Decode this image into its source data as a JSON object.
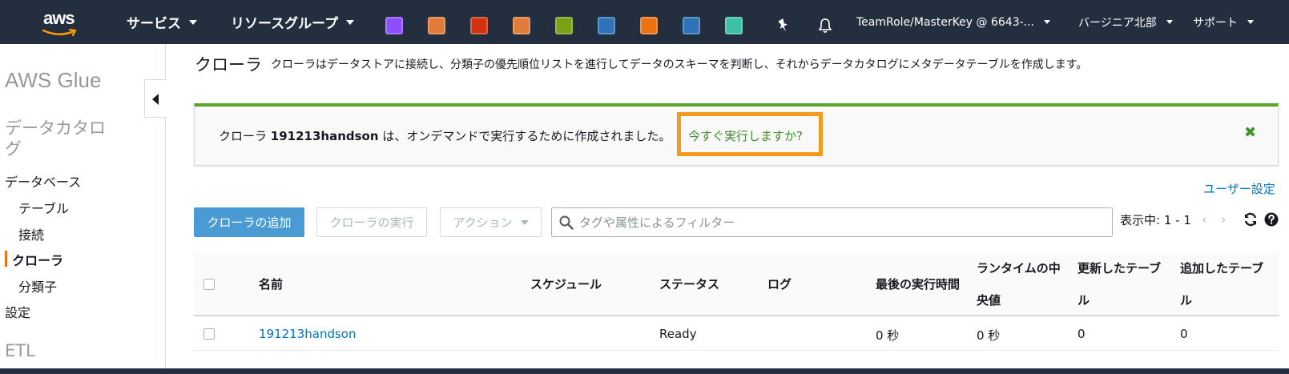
{
  "topnav": {
    "logo_text": "aws",
    "services_label": "サービス",
    "resource_groups_label": "リソースグループ",
    "service_icons": [
      {
        "name": "athena-icon",
        "color": "#8c4fff"
      },
      {
        "name": "sagemaker-icon",
        "color": "#e07b39"
      },
      {
        "name": "redshift-icon",
        "color": "#d13212"
      },
      {
        "name": "datasync-icon",
        "color": "#e07b39"
      },
      {
        "name": "kms-icon",
        "color": "#7aa116"
      },
      {
        "name": "redshift-cluster-icon",
        "color": "#2e73b8"
      },
      {
        "name": "ec2-icon",
        "color": "#ec7211"
      },
      {
        "name": "dynamodb-icon",
        "color": "#2e73b8"
      },
      {
        "name": "glue-icon",
        "color": "#3cbfa3"
      }
    ],
    "pin_icon": "pin-icon",
    "bell_icon": "bell-icon",
    "account_label": "TeamRole/MasterKey @ 6643-...",
    "region_label": "バージニア北部",
    "support_label": "サポート"
  },
  "sidebar": {
    "title": "AWS Glue",
    "section_catalog": "データカタロ\nグ",
    "items": [
      {
        "label": "データベース",
        "active": false
      },
      {
        "label": "テーブル",
        "active": false
      },
      {
        "label": "接続",
        "active": false
      },
      {
        "label": "クローラ",
        "active": true
      },
      {
        "label": "分類子",
        "active": false
      },
      {
        "label": "設定",
        "active": false
      }
    ],
    "section_etl": "ETL",
    "accent_color": "#ec7211"
  },
  "main": {
    "title": "クローラ",
    "description": "クローラはデータストアに接続し、分類子の優先順位リストを進行してデータのスキーマを判断し、それからデータカタログにメタデータテーブルを作成します。",
    "alert": {
      "prefix": "クローラ ",
      "crawler_name": "191213handson",
      "suffix": " は、オンデマンドで実行するために作成されました。",
      "link": "今すぐ実行しますか?",
      "close": "✖",
      "color": "#5aa629"
    },
    "user_settings": "ユーザー設定",
    "toolbar": {
      "add_crawler": "クローラの追加",
      "run_crawler": "クローラの実行",
      "actions": "アクション",
      "filter_placeholder": "タグや属性によるフィルター",
      "pager": "表示中: 1 - 1",
      "prev": "‹",
      "next": "›"
    },
    "table": {
      "columns": [
        {
          "line1": "名前",
          "line2": ""
        },
        {
          "line1": "スケジュール",
          "line2": ""
        },
        {
          "line1": "ステータス",
          "line2": ""
        },
        {
          "line1": "ログ",
          "line2": ""
        },
        {
          "line1": "最後の実行時間",
          "line2": ""
        },
        {
          "line1": "ランタイムの中",
          "line2": "央値"
        },
        {
          "line1": "更新したテーブ",
          "line2": "ル"
        },
        {
          "line1": "追加したテーブ",
          "line2": "ル"
        }
      ],
      "rows": [
        {
          "name": "191213handson",
          "schedule": "",
          "status": "Ready",
          "log": "",
          "last_runtime": "0 秒",
          "median_runtime": "0 秒",
          "tables_updated": "0",
          "tables_added": "0"
        }
      ]
    }
  }
}
